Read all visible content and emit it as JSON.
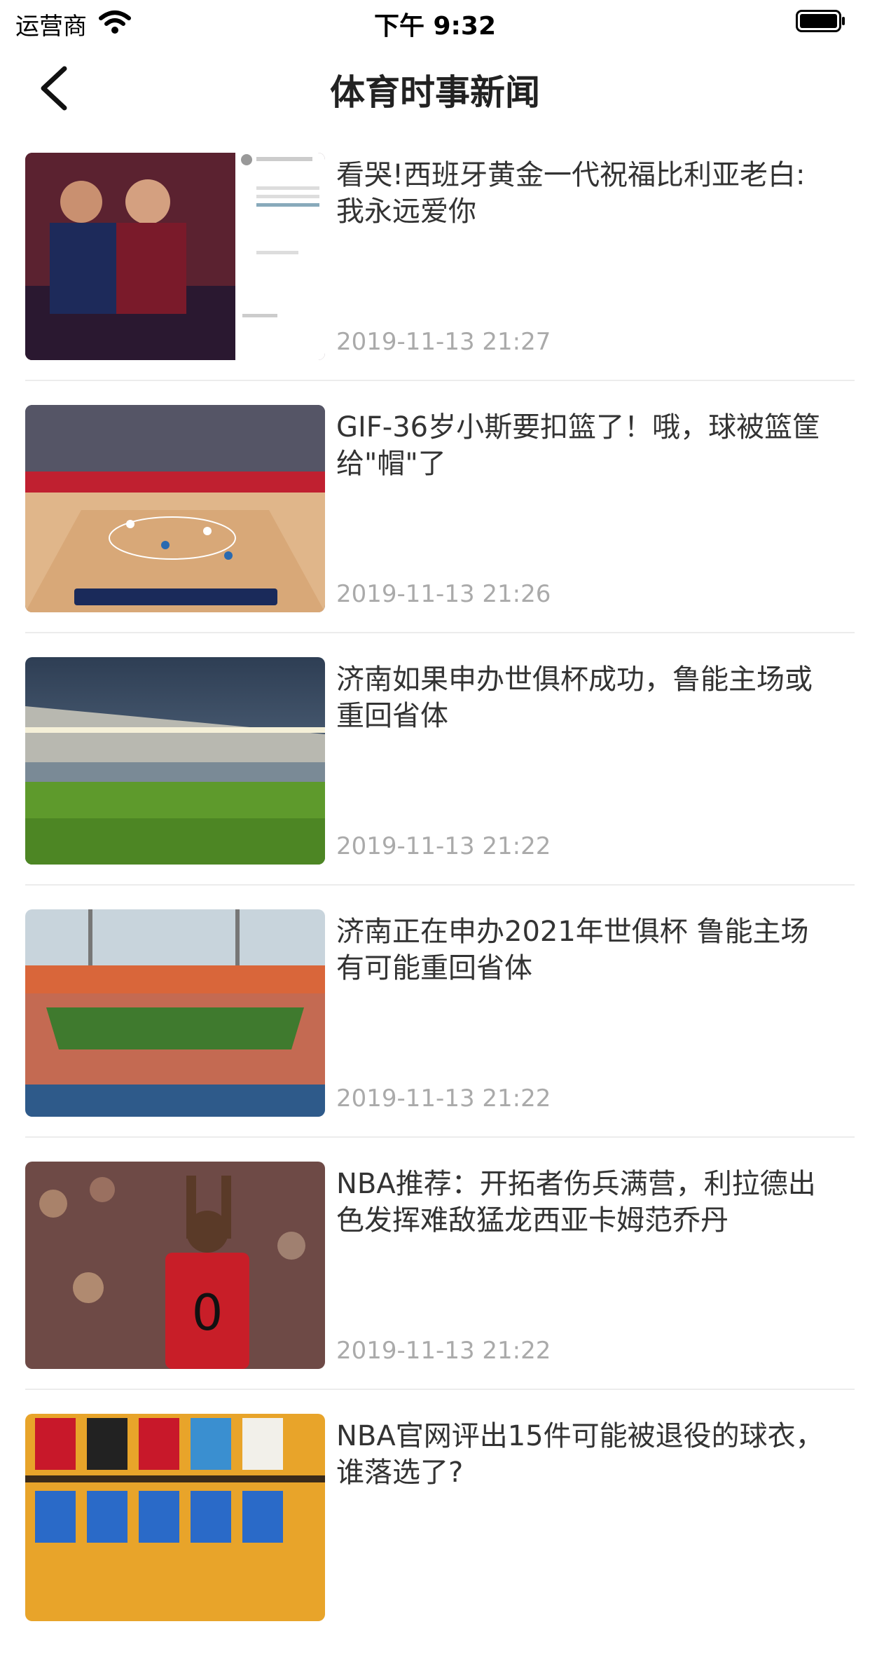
{
  "status_bar": {
    "carrier": "运营商",
    "time": "下午 9:32",
    "wifi_icon": "wifi-icon",
    "battery_icon": "battery-icon"
  },
  "nav": {
    "back_icon": "chevron-left-icon",
    "title": "体育时事新闻"
  },
  "news": [
    {
      "title": "看哭!西班牙黄金一代祝福比利亚老白:我永远爱你",
      "date": "2019-11-13 21:27",
      "thumb": "soccer-players-photo"
    },
    {
      "title": "GIF-36岁小斯要扣篮了！哦，球被篮筐给\"帽\"了",
      "date": "2019-11-13 21:26",
      "thumb": "basketball-court-photo"
    },
    {
      "title": "济南如果申办世俱杯成功，鲁能主场或重回省体",
      "date": "2019-11-13 21:22",
      "thumb": "stadium-grass-photo"
    },
    {
      "title": "济南正在申办2021年世俱杯 鲁能主场有可能重回省体",
      "date": "2019-11-13 21:22",
      "thumb": "stadium-overview-photo"
    },
    {
      "title": "NBA推荐：开拓者伤兵满营，利拉德出色发挥难敌猛龙西亚卡姆范乔丹",
      "date": "2019-11-13 21:22",
      "thumb": "basketball-player-photo"
    },
    {
      "title": "NBA官网评出15件可能被退役的球衣，谁落选了?",
      "date": "",
      "thumb": "jerseys-photo"
    }
  ]
}
